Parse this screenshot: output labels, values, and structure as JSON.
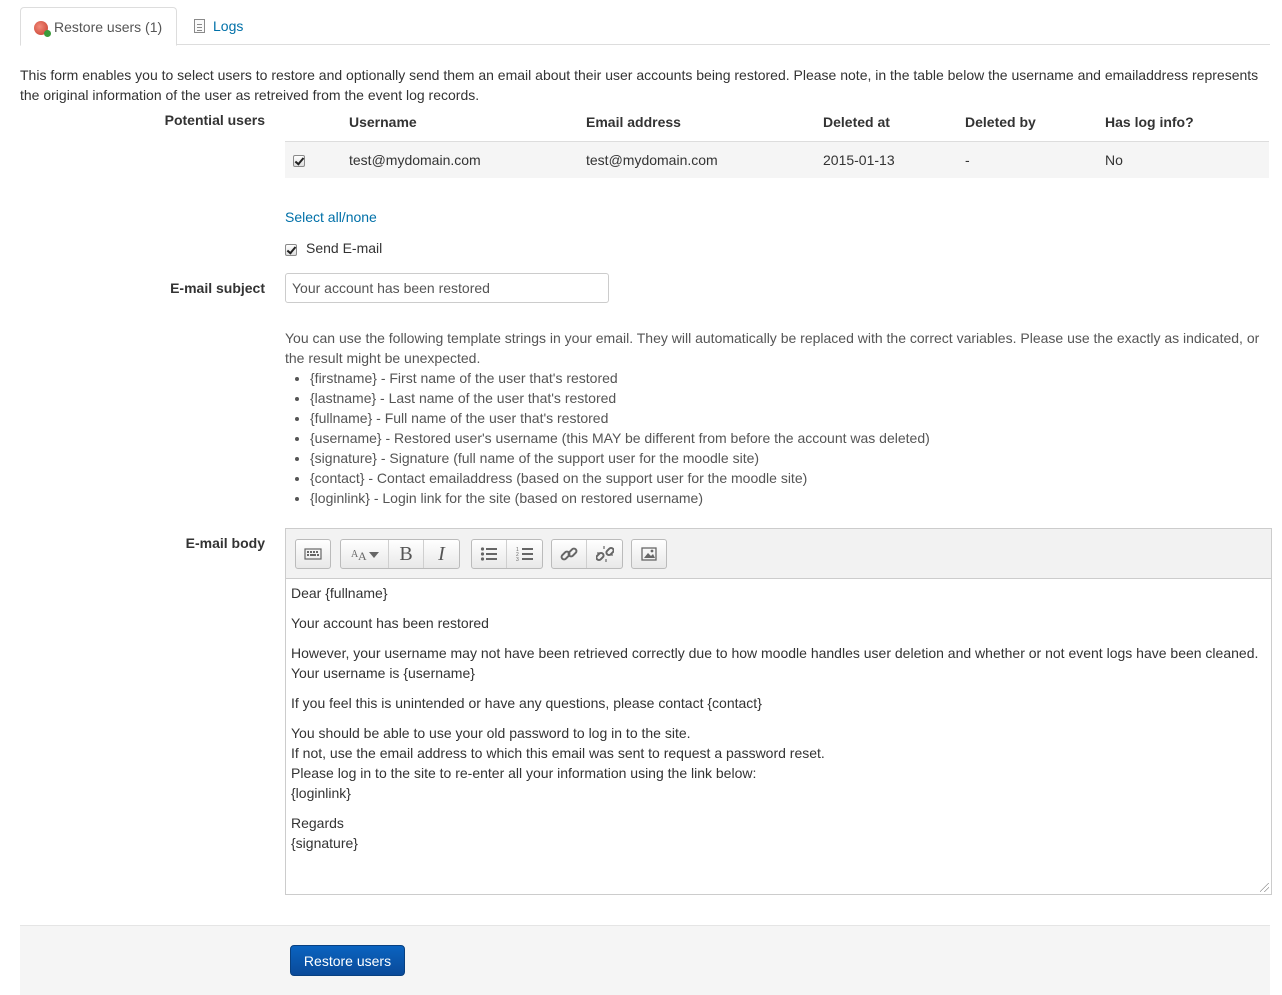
{
  "tabs": [
    {
      "label": "Restore users (1)",
      "icon": "restore-users-icon",
      "active": true
    },
    {
      "label": "Logs",
      "icon": "log-document-icon",
      "active": false
    }
  ],
  "intro_text": "This form enables you to select users to restore and optionally send them an email about their user accounts being restored. Please note, in the table below the username and emailaddress represents the original information of the user as retreived from the event log records.",
  "potential_users": {
    "label": "Potential users",
    "columns": [
      "",
      "Username",
      "Email address",
      "Deleted at",
      "Deleted by",
      "Has log info?"
    ],
    "rows": [
      {
        "checked": true,
        "username": "test@mydomain.com",
        "email": "test@mydomain.com",
        "deleted_at": "2015-01-13",
        "deleted_by": "-",
        "has_log_info": "No"
      }
    ],
    "select_all": "Select all/none"
  },
  "send_email": {
    "label": "Send E-mail",
    "checked": true
  },
  "email_subject": {
    "label": "E-mail subject",
    "value": "Your account has been restored"
  },
  "template_help": {
    "intro": "You can use the following template strings in your email. They will automatically be replaced with the correct variables. Please use the exactly as indicated, or the result might be unexpected.",
    "items": [
      "{firstname} - First name of the user that's restored",
      "{lastname} - Last name of the user that's restored",
      "{fullname} - Full name of the user that's restored",
      "{username} - Restored user's username (this MAY be different from before the account was deleted)",
      "{signature} - Signature (full name of the support user for the moodle site)",
      "{contact} - Contact emailaddress (based on the support user for the moodle site)",
      "{loginlink} - Login link for the site (based on restored username)"
    ]
  },
  "email_body": {
    "label": "E-mail body",
    "toolbar_icons": [
      "keyboard-icon",
      "font-style-icon",
      "bold-icon",
      "italic-icon",
      "unordered-list-icon",
      "ordered-list-icon",
      "link-icon",
      "unlink-icon",
      "image-icon"
    ],
    "lines": {
      "greeting": "Dear {fullname}",
      "p1": "Your account has been restored",
      "p2": "However, your username may not have been retrieved correctly due to how moodle handles user deletion and whether or not event logs have been cleaned. Your username is {username}",
      "p3": "If you feel this is unintended or have any questions, please contact {contact}",
      "p4a": "You should be able to use your old password to log in to the site.",
      "p4b": "If not, use the email address to which this email was sent to request a password reset.",
      "p4c": "Please log in to the site to re-enter all your information using the link below:",
      "p4d": "{loginlink}",
      "p5a": "Regards",
      "p5b": "{signature}"
    }
  },
  "submit": {
    "label": "Restore users",
    "color": "#0a5bb5"
  },
  "colors": {
    "link": "#0070a8",
    "text": "#333333",
    "footer_bg": "#f5f5f5"
  }
}
